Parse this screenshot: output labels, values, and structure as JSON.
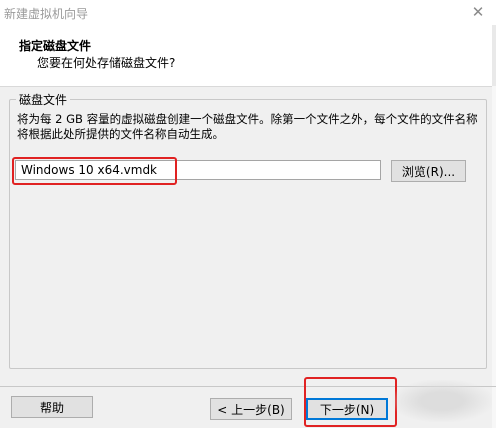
{
  "window": {
    "title": "新建虚拟机向导",
    "close_icon": "close-icon"
  },
  "header": {
    "title": "指定磁盘文件",
    "subtitle": "您要在何处存储磁盘文件?"
  },
  "disk_file": {
    "group_label": "磁盘文件",
    "description": "将为每 2 GB 容量的虚拟磁盘创建一个磁盘文件。除第一个文件之外，每个文件的文件名称将根据此处所提供的文件名称自动生成。",
    "file_name": "Windows 10 x64.vmdk",
    "browse_label": "浏览(R)..."
  },
  "footer": {
    "help_label": "帮助",
    "back_label": "< 上一步(B)",
    "next_label": "下一步(N)"
  },
  "annotations": {
    "highlight_color": "#e02222"
  }
}
